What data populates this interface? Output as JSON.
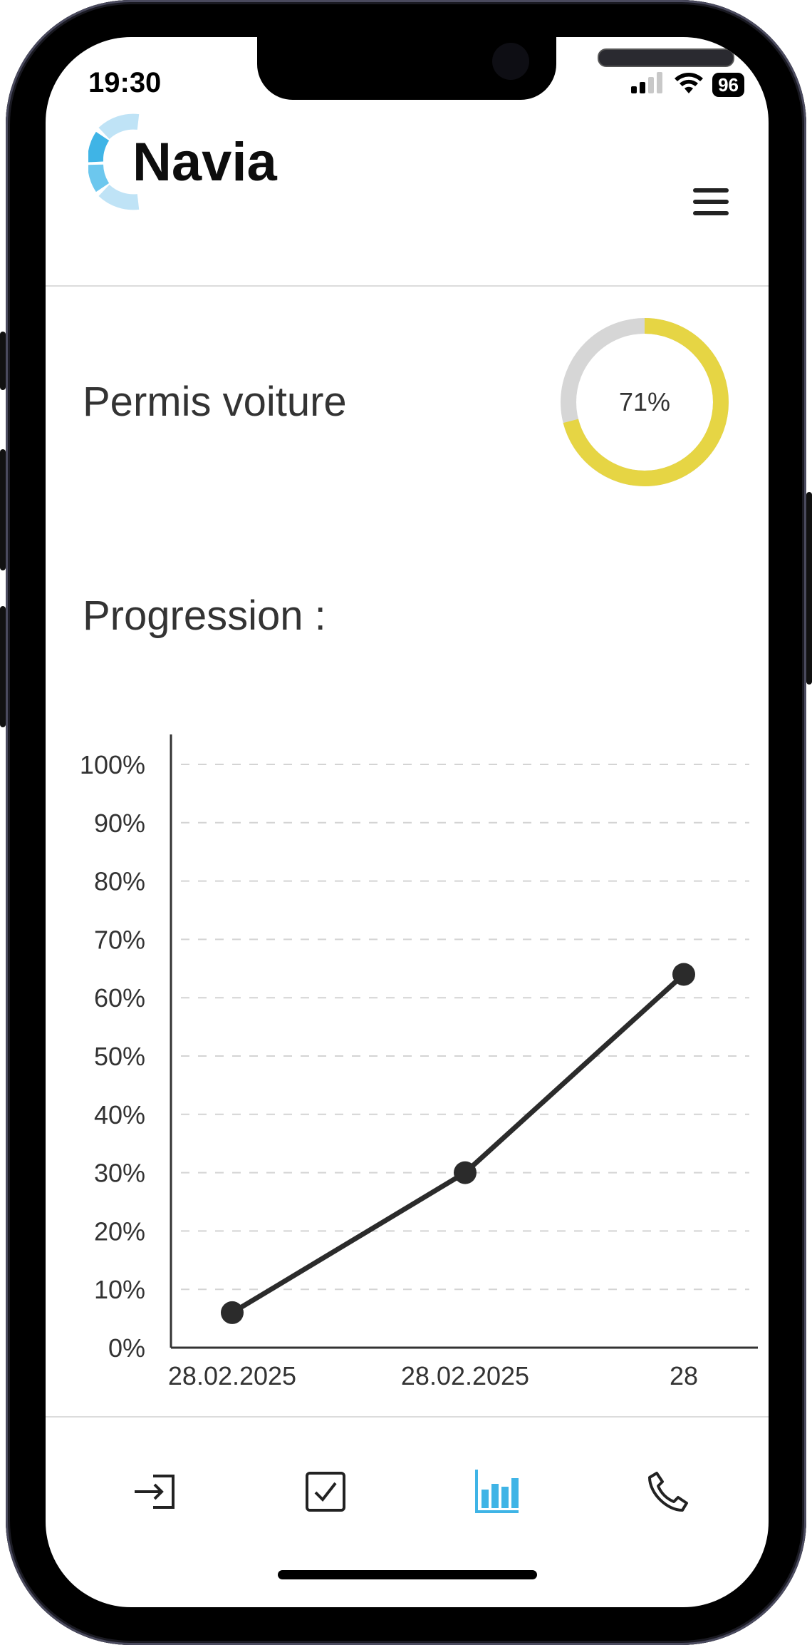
{
  "status_bar": {
    "time": "19:30",
    "battery": "96"
  },
  "header": {
    "logo_text": "Navia",
    "menu_icon": "hamburger-menu-icon"
  },
  "course": {
    "title": "Permis voiture",
    "progress_label": "71%",
    "progress_value": 71,
    "colors": {
      "done": "#e6d544",
      "remaining": "#d6d6d6"
    }
  },
  "progression": {
    "title": "Progression :"
  },
  "chart_data": {
    "type": "line",
    "x": [
      "28.02.2025",
      "28.02.2025",
      "28"
    ],
    "y": [
      6,
      30,
      64
    ],
    "ylim": [
      0,
      100
    ],
    "yticks": [
      "0%",
      "10%",
      "20%",
      "30%",
      "40%",
      "50%",
      "60%",
      "70%",
      "80%",
      "90%",
      "100%"
    ],
    "grid": true,
    "line_color": "#2b2b2b"
  },
  "tabbar": {
    "items": [
      {
        "icon": "login-icon",
        "active": false
      },
      {
        "icon": "checkbox-icon",
        "active": false
      },
      {
        "icon": "bar-chart-icon",
        "active": true
      },
      {
        "icon": "phone-icon",
        "active": false
      }
    ],
    "active_color": "#3fb4e6"
  }
}
